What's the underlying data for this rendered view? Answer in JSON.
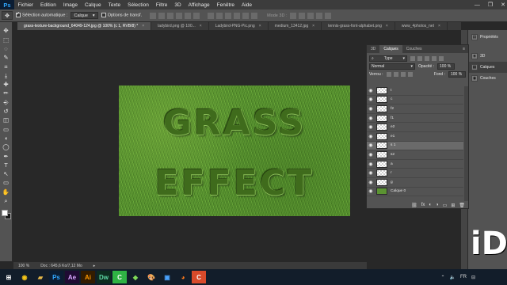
{
  "app": {
    "logo": "Ps"
  },
  "menu": [
    "Fichier",
    "Edition",
    "Image",
    "Calque",
    "Texte",
    "Sélection",
    "Filtre",
    "3D",
    "Affichage",
    "Fenêtre",
    "Aide"
  ],
  "window_controls": {
    "minimize": "—",
    "maximize": "❐",
    "close": "✕"
  },
  "options": {
    "auto_select_label": "Sélection automatique :",
    "auto_select_value": "Calque",
    "transform_label": "Options de transf.",
    "mode_3d_label": "Mode 3D :"
  },
  "tabs": [
    {
      "label": "grass-texture-background_64049-124.jpg @ 100% (c 1, RVB/8) *",
      "active": true
    },
    {
      "label": "ladybird.png @ 100...",
      "active": false
    },
    {
      "label": "Ladybird-PNG-Pic.png",
      "active": false
    },
    {
      "label": "medium_13412.jpg",
      "active": false
    },
    {
      "label": "tennis-grass-font-alphabet.png",
      "active": false
    },
    {
      "label": "www_4photos_net",
      "active": false
    }
  ],
  "tools": [
    "move-icon",
    "marquee-icon",
    "lasso-icon",
    "quick-select-icon",
    "crop-icon",
    "eyedropper-icon",
    "healing-icon",
    "brush-icon",
    "stamp-icon",
    "history-brush-icon",
    "eraser-icon",
    "gradient-icon",
    "blur-icon",
    "dodge-icon",
    "pen-icon",
    "type-icon",
    "path-select-icon",
    "shape-icon",
    "hand-icon",
    "zoom-icon"
  ],
  "tool_glyphs": [
    "✥",
    "⬚",
    "◌",
    "✎",
    "⌗",
    "⤓",
    "✚",
    "✏",
    "⎆",
    "↺",
    "◫",
    "▭",
    "◖",
    "◯",
    "✒",
    "T",
    "↖",
    "▭",
    "✋",
    "⌕"
  ],
  "canvas": {
    "word1": "GRASS",
    "word2": "EFFECT"
  },
  "status": {
    "zoom": "100 %",
    "doc": "Doc : 645,6 Ko/7,12 Mo",
    "arrow": "▸"
  },
  "right_dock": [
    {
      "label": "Propriétés",
      "icon": "properties-icon",
      "glyph": "▤",
      "active": false
    },
    {
      "label": "3D",
      "icon": "3d-icon",
      "glyph": "◈",
      "active": false
    },
    {
      "label": "Calques",
      "icon": "layers-icon",
      "glyph": "▦",
      "active": true
    },
    {
      "label": "Couches",
      "icon": "channels-icon",
      "glyph": "◉",
      "active": false
    }
  ],
  "layers_panel": {
    "tabs": [
      "3D",
      "Calques",
      "Couches"
    ],
    "active_tab": "Calques",
    "filter": "Type",
    "blend_mode": "Normal",
    "opacity_label": "Opacité :",
    "opacity_value": "100 %",
    "lock_label": "Verrou :",
    "fill_label": "Fond :",
    "fill_value": "100 %",
    "layers": [
      {
        "name": "t",
        "thumb": "transparent",
        "selected": false
      },
      {
        "name": "c",
        "thumb": "transparent",
        "selected": false
      },
      {
        "name": "f2",
        "thumb": "transparent",
        "selected": false
      },
      {
        "name": "f1",
        "thumb": "transparent",
        "selected": false
      },
      {
        "name": "e2",
        "thumb": "transparent",
        "selected": false
      },
      {
        "name": "e1",
        "thumb": "transparent",
        "selected": false
      },
      {
        "name": "s 1",
        "thumb": "transparent",
        "selected": true
      },
      {
        "name": "s2",
        "thumb": "transparent",
        "selected": false
      },
      {
        "name": "a",
        "thumb": "transparent",
        "selected": false
      },
      {
        "name": "r",
        "thumb": "transparent",
        "selected": false
      },
      {
        "name": "g",
        "thumb": "transparent",
        "selected": false
      },
      {
        "name": "Calque 0",
        "thumb": "green",
        "selected": false
      }
    ],
    "footer_icons": [
      "link-icon",
      "fx-icon",
      "mask-icon",
      "adjustment-icon",
      "group-icon",
      "new-layer-icon",
      "trash-icon"
    ],
    "footer_glyphs": [
      "⛓",
      "fx",
      "◐",
      "◑",
      "▭",
      "⊞",
      "🗑"
    ]
  },
  "taskbar": {
    "apps": [
      {
        "name": "start-icon",
        "glyph": "⊞",
        "color": "#ffffff",
        "bg": "transparent"
      },
      {
        "name": "chrome-icon",
        "glyph": "◉",
        "color": "#f5c518",
        "bg": "transparent"
      },
      {
        "name": "explorer-icon",
        "glyph": "▰",
        "color": "#e6b84a",
        "bg": "transparent"
      },
      {
        "name": "ps-taskbar-icon",
        "glyph": "Ps",
        "color": "#31a8ff",
        "bg": "#0b1d33"
      },
      {
        "name": "ae-icon",
        "glyph": "Ae",
        "color": "#d9a6ff",
        "bg": "#1f0b33"
      },
      {
        "name": "ai-icon",
        "glyph": "Ai",
        "color": "#ff9a00",
        "bg": "#331c00"
      },
      {
        "name": "dw-icon",
        "glyph": "Dw",
        "color": "#5ed9a6",
        "bg": "#0d2b1f"
      },
      {
        "name": "camtasia-icon",
        "glyph": "C",
        "color": "#ffffff",
        "bg": "#2fb344"
      },
      {
        "name": "green-app-icon",
        "glyph": "◆",
        "color": "#7ed957",
        "bg": "transparent"
      },
      {
        "name": "paint-icon",
        "glyph": "🎨",
        "color": "#ffffff",
        "bg": "transparent"
      },
      {
        "name": "media-icon",
        "glyph": "▣",
        "color": "#4aa3ff",
        "bg": "transparent"
      },
      {
        "name": "firefox-icon",
        "glyph": "◕",
        "color": "#ff7a1a",
        "bg": "transparent"
      },
      {
        "name": "camtasia2-icon",
        "glyph": "C",
        "color": "#ffffff",
        "bg": "#d94a2a"
      }
    ],
    "lang": "FR",
    "tray_glyphs": [
      "⌃",
      "🔈",
      "⊟"
    ]
  },
  "watermark": "iD",
  "colors": {
    "canvas_bg": "#282828",
    "panel": "#535353",
    "accent": "#31a8ff"
  }
}
